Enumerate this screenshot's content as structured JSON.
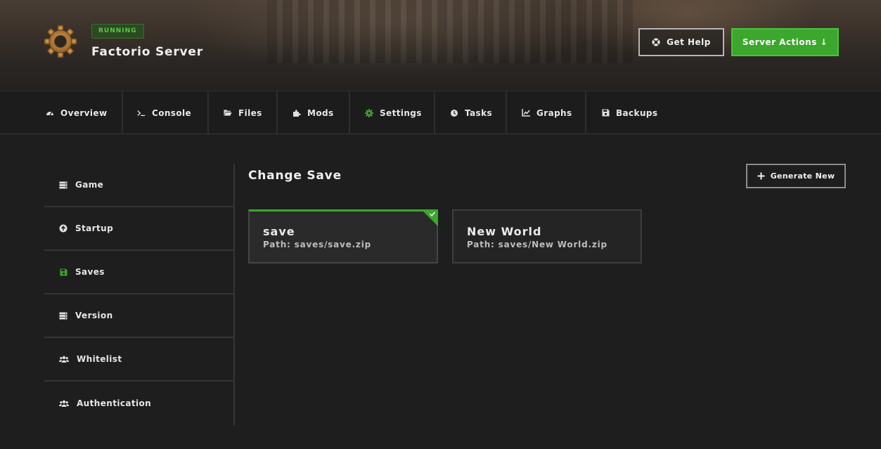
{
  "header": {
    "status": "RUNNING",
    "server_name": "Factorio Server",
    "get_help_label": "Get Help",
    "server_actions_label": "Server Actions ↓"
  },
  "nav": {
    "tabs": [
      {
        "label": "Overview",
        "icon": "dashboard-icon"
      },
      {
        "label": "Console",
        "icon": "terminal-icon"
      },
      {
        "label": "Files",
        "icon": "folder-icon"
      },
      {
        "label": "Mods",
        "icon": "puzzle-icon"
      },
      {
        "label": "Settings",
        "icon": "gear-icon",
        "active": true
      },
      {
        "label": "Tasks",
        "icon": "clock-icon"
      },
      {
        "label": "Graphs",
        "icon": "chart-icon"
      },
      {
        "label": "Backups",
        "icon": "floppy-icon"
      }
    ]
  },
  "sidebar": {
    "items": [
      {
        "label": "Game",
        "icon": "server-icon"
      },
      {
        "label": "Startup",
        "icon": "arrow-up-circle-icon"
      },
      {
        "label": "Saves",
        "icon": "floppy-icon",
        "active": true
      },
      {
        "label": "Version",
        "icon": "server-icon"
      },
      {
        "label": "Whitelist",
        "icon": "users-icon"
      },
      {
        "label": "Authentication",
        "icon": "users-icon"
      }
    ]
  },
  "main": {
    "title": "Change Save",
    "generate_label": "Generate New",
    "saves": [
      {
        "name": "save",
        "path": "Path: saves/save.zip",
        "selected": true
      },
      {
        "name": "New World",
        "path": "Path: saves/New World.zip",
        "selected": false
      }
    ]
  },
  "colors": {
    "accent": "#3ba72c",
    "background": "#1e1e1e",
    "status_text": "#5ec544"
  }
}
